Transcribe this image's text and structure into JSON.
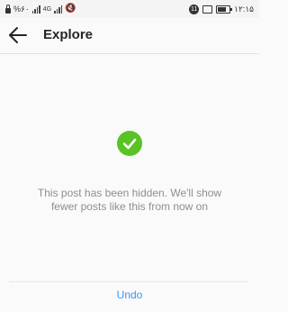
{
  "status_bar": {
    "left_text": "%۶۰",
    "network_label": "4G",
    "notification_count": "11",
    "time": "۱۲:۱۵",
    "battery_level": 0.6
  },
  "header": {
    "title": "Explore",
    "back_icon": "arrow-left-icon"
  },
  "confirmation": {
    "icon": "checkmark-icon",
    "icon_color": "#58c322",
    "message_line1": "This post has been hidden. We'll show",
    "message_line2": "fewer posts like this from now on"
  },
  "actions": {
    "undo_label": "Undo",
    "undo_color": "#3897f0"
  }
}
